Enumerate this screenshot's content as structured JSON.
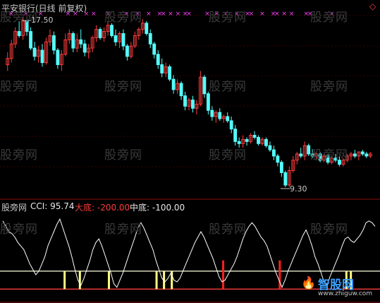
{
  "top_panel": {
    "title": "平安银行(日线 前复权)",
    "marker_glyph": "◇",
    "high_label": "17.50",
    "low_label": "9.30"
  },
  "bottom_panel": {
    "legend_name": "股旁网",
    "cci_label": "CCI: 95.74",
    "dadi_label": "大底: -200.00",
    "zhongdi_label": "中底: -100.00"
  },
  "watermark_text": "股旁网",
  "logo_text": "智股网",
  "logo_url": "www.zhiguw.com",
  "colors": {
    "up": "#ff3c3c",
    "down": "#54ffff",
    "cci": "#ffffff",
    "level_line": "#ffffe0",
    "signal_yellow": "#ffff80",
    "signal_red": "#ff2020",
    "marker": "#ff40ff",
    "title": "#c0c0c0"
  },
  "chart_data": {
    "type": "candlestick+line",
    "candles_approx": [
      [
        15.2,
        15.8,
        14.9,
        15.5
      ],
      [
        15.5,
        16.4,
        15.3,
        16.2
      ],
      [
        16.2,
        17.0,
        16.0,
        16.8
      ],
      [
        16.8,
        17.3,
        16.5,
        16.6
      ],
      [
        16.6,
        17.5,
        16.4,
        17.3
      ],
      [
        17.3,
        17.5,
        16.6,
        16.8
      ],
      [
        16.8,
        17.0,
        15.9,
        16.0
      ],
      [
        16.0,
        16.3,
        15.4,
        15.6
      ],
      [
        15.6,
        16.1,
        15.3,
        15.9
      ],
      [
        15.9,
        16.2,
        15.1,
        15.3
      ],
      [
        15.3,
        16.5,
        15.2,
        16.3
      ],
      [
        16.3,
        16.9,
        16.1,
        16.6
      ],
      [
        16.6,
        16.8,
        15.7,
        15.9
      ],
      [
        15.9,
        16.0,
        15.0,
        15.2
      ],
      [
        15.2,
        15.9,
        14.9,
        15.7
      ],
      [
        15.7,
        16.7,
        15.6,
        16.4
      ],
      [
        16.4,
        16.9,
        16.2,
        16.7
      ],
      [
        16.7,
        16.8,
        15.8,
        16.0
      ],
      [
        16.0,
        16.7,
        15.8,
        16.4
      ],
      [
        16.4,
        16.9,
        16.0,
        16.2
      ],
      [
        16.2,
        16.4,
        15.6,
        15.8
      ],
      [
        15.8,
        16.2,
        15.5,
        16.0
      ],
      [
        16.0,
        16.6,
        15.8,
        16.5
      ],
      [
        16.5,
        17.1,
        16.3,
        16.9
      ],
      [
        16.9,
        17.0,
        16.4,
        16.5
      ],
      [
        16.5,
        17.0,
        16.3,
        16.8
      ],
      [
        16.8,
        17.3,
        16.6,
        17.1
      ],
      [
        17.1,
        17.2,
        16.5,
        16.6
      ],
      [
        16.6,
        16.9,
        16.1,
        16.3
      ],
      [
        16.3,
        16.8,
        16.0,
        16.7
      ],
      [
        16.7,
        16.9,
        15.9,
        16.1
      ],
      [
        16.1,
        16.2,
        15.4,
        15.6
      ],
      [
        15.6,
        16.3,
        15.5,
        16.1
      ],
      [
        16.1,
        16.8,
        16.0,
        16.6
      ],
      [
        16.6,
        17.0,
        16.4,
        16.9
      ],
      [
        16.9,
        17.4,
        16.7,
        17.2
      ],
      [
        17.2,
        17.3,
        16.6,
        16.7
      ],
      [
        16.7,
        16.9,
        16.0,
        16.2
      ],
      [
        16.2,
        16.3,
        15.5,
        15.7
      ],
      [
        15.7,
        15.9,
        15.0,
        15.2
      ],
      [
        15.2,
        15.5,
        14.6,
        14.8
      ],
      [
        14.8,
        15.3,
        14.6,
        15.1
      ],
      [
        15.1,
        15.2,
        14.4,
        14.5
      ],
      [
        14.5,
        14.7,
        13.8,
        14.0
      ],
      [
        14.0,
        14.5,
        13.8,
        14.3
      ],
      [
        14.3,
        14.4,
        13.5,
        13.7
      ],
      [
        13.7,
        13.9,
        13.0,
        13.2
      ],
      [
        13.2,
        13.6,
        13.0,
        13.5
      ],
      [
        13.5,
        13.7,
        12.9,
        13.1
      ],
      [
        13.1,
        13.5,
        12.8,
        13.3
      ],
      [
        13.3,
        14.9,
        13.2,
        14.6
      ],
      [
        14.6,
        14.7,
        13.6,
        13.8
      ],
      [
        13.8,
        13.9,
        12.8,
        13.0
      ],
      [
        13.0,
        13.2,
        12.5,
        12.7
      ],
      [
        12.7,
        13.0,
        12.4,
        12.9
      ],
      [
        12.9,
        13.1,
        12.5,
        12.6
      ],
      [
        12.6,
        12.8,
        12.4,
        12.7
      ],
      [
        12.7,
        12.9,
        12.4,
        12.5
      ],
      [
        12.5,
        12.7,
        11.9,
        12.1
      ],
      [
        12.1,
        12.3,
        11.3,
        11.5
      ],
      [
        11.5,
        11.7,
        11.2,
        11.4
      ],
      [
        11.4,
        11.8,
        11.2,
        11.6
      ],
      [
        11.6,
        11.7,
        11.3,
        11.5
      ],
      [
        11.5,
        11.9,
        11.4,
        11.8
      ],
      [
        11.8,
        12.0,
        11.6,
        11.7
      ],
      [
        11.7,
        11.8,
        11.3,
        11.4
      ],
      [
        11.4,
        11.7,
        11.3,
        11.6
      ],
      [
        11.6,
        11.7,
        11.2,
        11.3
      ],
      [
        11.3,
        11.5,
        11.0,
        11.1
      ],
      [
        11.1,
        11.3,
        10.6,
        10.8
      ],
      [
        10.8,
        10.9,
        10.3,
        10.5
      ],
      [
        10.5,
        10.6,
        9.8,
        10.0
      ],
      [
        10.0,
        10.1,
        9.3,
        9.4
      ],
      [
        9.4,
        10.3,
        9.3,
        10.1
      ],
      [
        10.1,
        10.8,
        10.0,
        10.6
      ],
      [
        10.6,
        11.0,
        10.4,
        10.9
      ],
      [
        10.9,
        11.2,
        10.7,
        10.8
      ],
      [
        10.8,
        11.5,
        10.6,
        11.3
      ],
      [
        11.3,
        11.4,
        10.8,
        10.9
      ],
      [
        10.9,
        11.1,
        10.7,
        10.8
      ],
      [
        10.8,
        11.0,
        10.6,
        10.9
      ],
      [
        10.9,
        11.0,
        10.5,
        10.6
      ],
      [
        10.6,
        10.9,
        10.5,
        10.8
      ],
      [
        10.8,
        10.9,
        10.4,
        10.5
      ],
      [
        10.5,
        10.8,
        10.4,
        10.7
      ],
      [
        10.7,
        10.9,
        10.5,
        10.6
      ],
      [
        10.6,
        10.8,
        10.3,
        10.4
      ],
      [
        10.4,
        10.7,
        10.3,
        10.6
      ],
      [
        10.6,
        10.9,
        10.5,
        10.8
      ],
      [
        10.8,
        11.0,
        10.6,
        10.9
      ],
      [
        10.9,
        11.1,
        10.7,
        10.8
      ],
      [
        10.8,
        11.0,
        10.6,
        11.0
      ],
      [
        11.0,
        11.1,
        10.8,
        10.9
      ],
      [
        10.9,
        11.0,
        10.7,
        10.8
      ],
      [
        10.8,
        11.0,
        10.7,
        10.9
      ]
    ],
    "cci_approx": [
      180,
      150,
      120,
      110,
      90,
      60,
      40,
      20,
      -20,
      -60,
      -90,
      -120,
      -100,
      -60,
      -20,
      40,
      80,
      120,
      160,
      190,
      140,
      90,
      40,
      -20,
      -90,
      -150,
      -180,
      -140,
      -90,
      -40,
      20,
      60,
      80,
      40,
      -10,
      -60,
      -110,
      -170,
      -190,
      -150,
      -110,
      -60,
      -10,
      40,
      90,
      140,
      170,
      140,
      100,
      60,
      20,
      -40,
      -90,
      -140,
      -160,
      -140,
      -110,
      -150,
      -160,
      -140,
      -100,
      -60,
      -20,
      20,
      60,
      90,
      120,
      90,
      50,
      10,
      -30,
      -80,
      -130,
      -160,
      -150,
      -120,
      -90,
      -60,
      -20,
      30,
      80,
      120,
      150,
      170,
      150,
      120,
      90,
      70,
      40,
      -10,
      -60,
      -110,
      -150,
      -190,
      -150,
      -100,
      -60,
      -20,
      20,
      60,
      100,
      130,
      90,
      40,
      -20,
      -60,
      -110,
      -160,
      -180,
      -130,
      -90,
      -50,
      -10,
      40,
      80,
      90,
      70,
      60,
      80,
      100,
      130,
      170,
      180,
      170,
      150
    ],
    "yellow_signal_positions": [
      0.166,
      0.207,
      0.285,
      0.413,
      0.433,
      0.454,
      0.923,
      0.935
    ],
    "red_signal_positions": [
      0.592,
      0.744
    ],
    "x_signal_positions": [
      0.015,
      0.055,
      0.095,
      0.17,
      0.19,
      0.22,
      0.24,
      0.28,
      0.33,
      0.36,
      0.39,
      0.42,
      0.43,
      0.45,
      0.47,
      0.49,
      0.5,
      0.55,
      0.575,
      0.6,
      0.63,
      0.66,
      0.67,
      0.7,
      0.73,
      0.74,
      0.76,
      0.78,
      0.82,
      0.83,
      0.89
    ],
    "levels": {
      "dadi": -200,
      "zhongdi": -100
    }
  }
}
